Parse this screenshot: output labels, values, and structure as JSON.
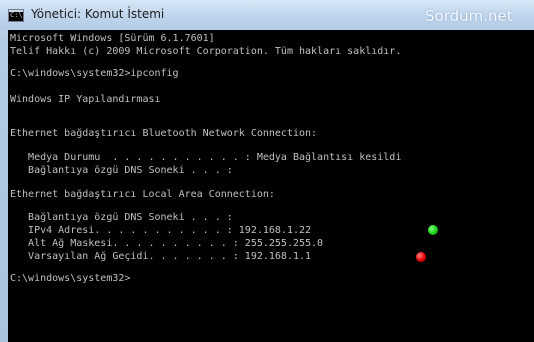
{
  "window": {
    "title": "Yönetici: Komut İstemi",
    "watermark": "Sordum.net",
    "icon_label": "C:\\"
  },
  "console": {
    "lines": [
      "Microsoft Windows [Sürüm 6.1.7601]",
      "Telif Hakkı (c) 2009 Microsoft Corporation. Tüm hakları saklıdır.",
      "",
      "C:\\windows\\system32>ipconfig",
      "",
      "Windows IP Yapılandırması",
      "",
      "",
      "Ethernet bağdaştırıcı Bluetooth Network Connection:",
      "",
      "   Medya Durumu  . . . . . . . . . . . : Medya Bağlantısı kesildi",
      "   Bağlantıya özgü DNS Soneki . . . :",
      "",
      "Ethernet bağdaştırıcı Local Area Connection:",
      "",
      "   Bağlantıya özgü DNS Soneki . . . :",
      "   IPv4 Adresi. . . . . . . . . . . : 192.168.1.22",
      "   Alt Ağ Maskesi. . . . . . . . . . : 255.255.255.0",
      "   Varsayılan Ağ Geçidi. . . . . . . : 192.168.1.1",
      "",
      "C:\\windows\\system32>"
    ],
    "markers": {
      "ipv4": "green",
      "gateway": "red"
    }
  },
  "colors": {
    "console_text": "#c0c0c0",
    "console_background": "#000000",
    "marker_green": "#1ccf1c",
    "marker_red": "#e80000"
  }
}
